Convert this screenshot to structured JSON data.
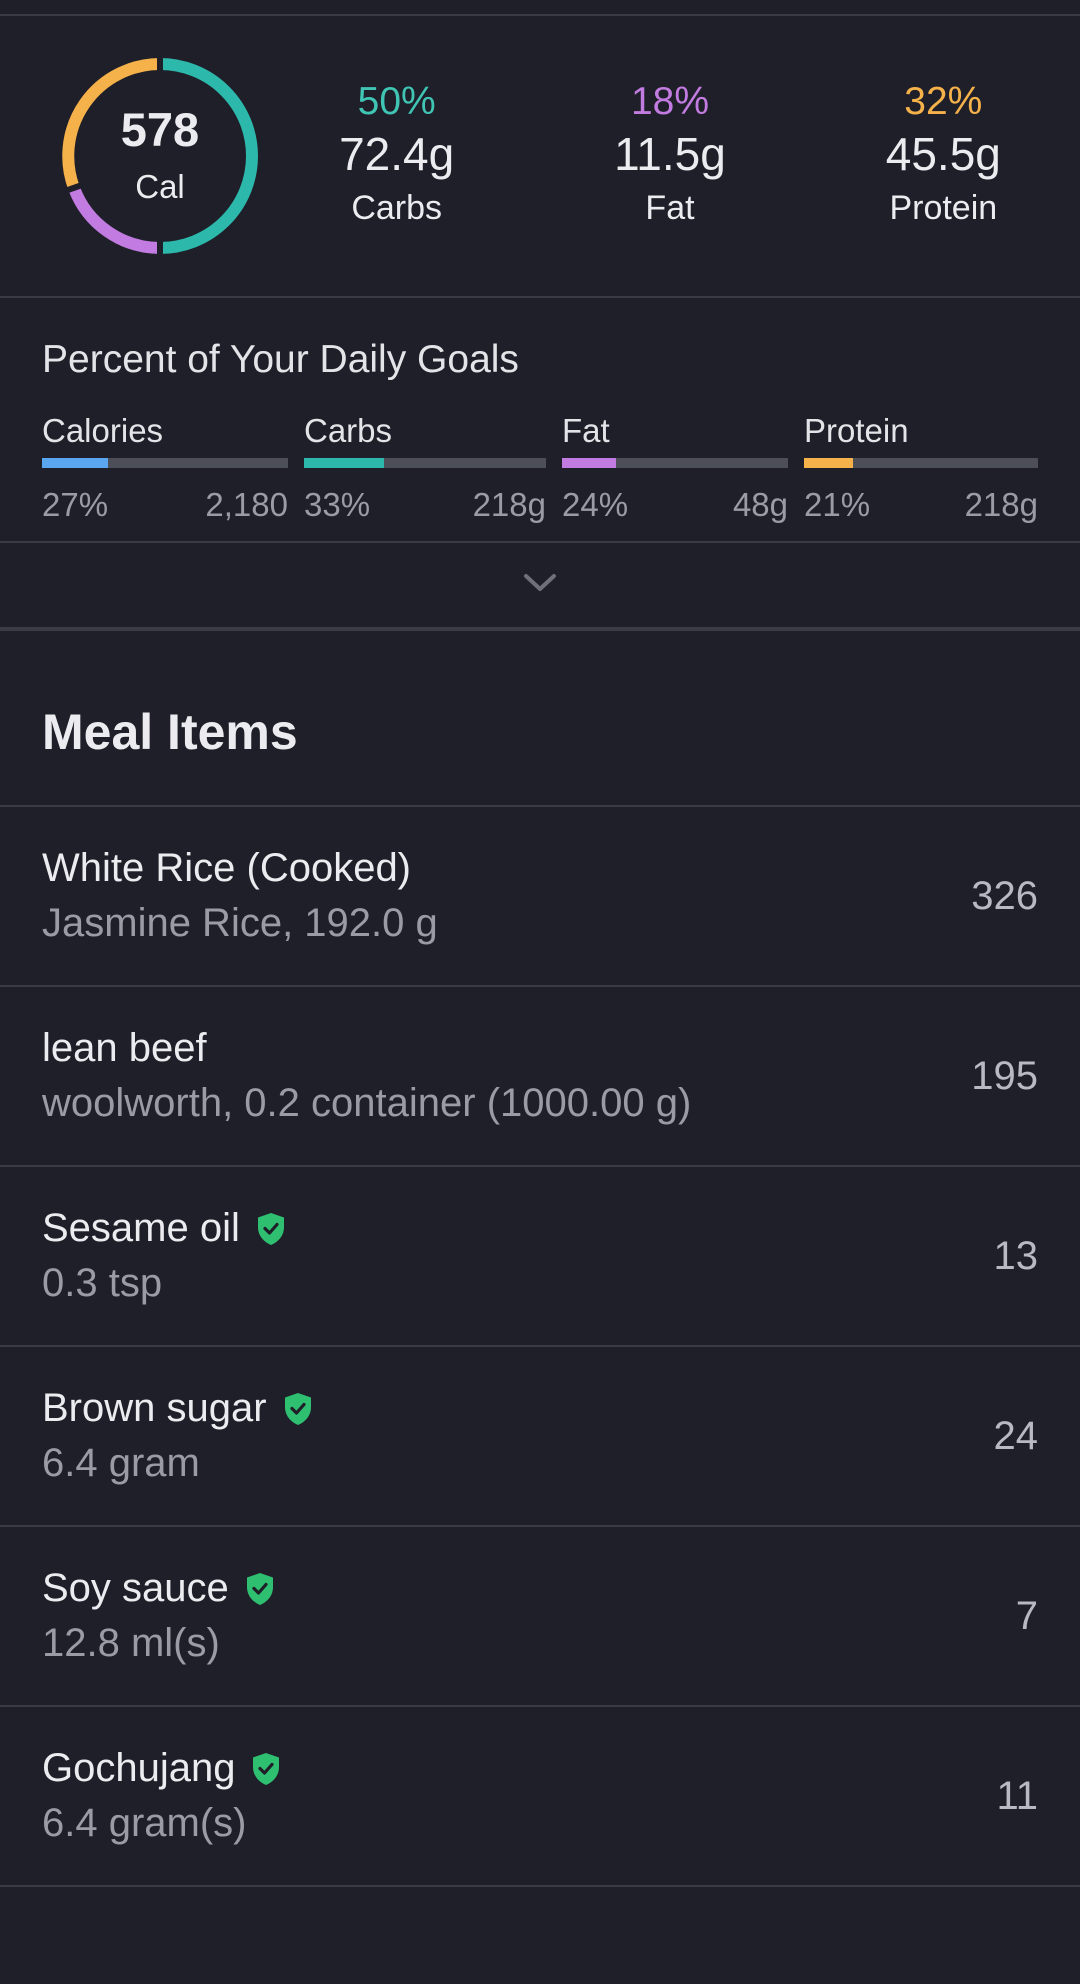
{
  "summary": {
    "calories": "578",
    "calories_unit": "Cal",
    "macros": [
      {
        "pct": "50%",
        "amount": "72.4g",
        "label": "Carbs",
        "color": "#40c4b4"
      },
      {
        "pct": "18%",
        "amount": "11.5g",
        "label": "Fat",
        "color": "#c27be0"
      },
      {
        "pct": "32%",
        "amount": "45.5g",
        "label": "Protein",
        "color": "#f5b14a"
      }
    ],
    "ring_colors": {
      "carbs": "#2db8ac",
      "fat": "#c27be0",
      "protein": "#f5b14a"
    }
  },
  "goals": {
    "title": "Percent of Your Daily Goals",
    "items": [
      {
        "name": "Calories",
        "percent": "27%",
        "target": "2,180",
        "fill": 0.27,
        "color": "#5aa6f0"
      },
      {
        "name": "Carbs",
        "percent": "33%",
        "target": "218g",
        "fill": 0.33,
        "color": "#2db8ac"
      },
      {
        "name": "Fat",
        "percent": "24%",
        "target": "48g",
        "fill": 0.24,
        "color": "#c27be0"
      },
      {
        "name": "Protein",
        "percent": "21%",
        "target": "218g",
        "fill": 0.21,
        "color": "#f5b14a"
      }
    ]
  },
  "expand_icon": "chevron-down-icon",
  "meal": {
    "title": "Meal Items",
    "items": [
      {
        "name": "White Rice (Cooked)",
        "desc": "Jasmine Rice, 192.0 g",
        "cal": "326",
        "verified": false
      },
      {
        "name": "lean beef",
        "desc": "woolworth, 0.2 container (1000.00 g)",
        "cal": "195",
        "verified": false
      },
      {
        "name": "Sesame oil",
        "desc": "0.3 tsp",
        "cal": "13",
        "verified": true
      },
      {
        "name": "Brown sugar",
        "desc": "6.4 gram",
        "cal": "24",
        "verified": true
      },
      {
        "name": "Soy sauce",
        "desc": "12.8 ml(s)",
        "cal": "7",
        "verified": true
      },
      {
        "name": "Gochujang",
        "desc": "6.4 gram(s)",
        "cal": "11",
        "verified": true
      }
    ],
    "verified_color": "#2fbf71"
  }
}
